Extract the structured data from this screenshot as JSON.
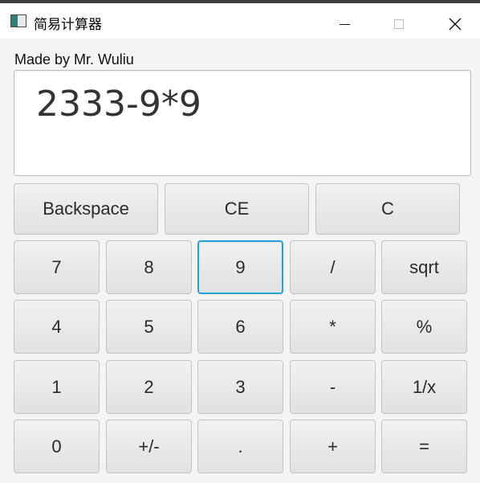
{
  "window": {
    "title": "简易计算器"
  },
  "credit": "Made by Mr. Wuliu",
  "display": {
    "expression": "2333-9*9"
  },
  "top_buttons": [
    "Backspace",
    "CE",
    "C"
  ],
  "keypad": [
    [
      "7",
      "8",
      "9",
      "/",
      "sqrt"
    ],
    [
      "4",
      "5",
      "6",
      "*",
      "%"
    ],
    [
      "1",
      "2",
      "3",
      "-",
      "1/x"
    ],
    [
      "0",
      "+/-",
      ".",
      "+",
      "="
    ]
  ],
  "focused_key": "9",
  "colors": {
    "focus_border": "#2a9fd6",
    "button_face": "#e6e6e6",
    "window_bg": "#f4f4f4"
  },
  "icons": {
    "minimize": "minimize-icon",
    "maximize": "maximize-icon",
    "close": "close-icon",
    "app": "app-icon"
  }
}
